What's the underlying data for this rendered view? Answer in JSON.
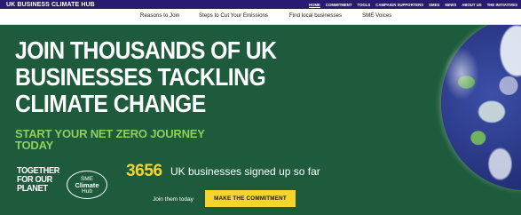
{
  "topbar": {
    "brand": "UK BUSINESS CLIMATE HUB",
    "nav": [
      "HOME",
      "COMMITMENT",
      "TOOLS",
      "CAMPAIGN SUPPORTERS",
      "SMES",
      "NEWS",
      "ABOUT US",
      "THE INITIATIVES"
    ],
    "active": "HOME",
    "background": "#2a1a73"
  },
  "subnav": {
    "items": [
      "Reasons to Join",
      "Steps to Cut Your Emissions",
      "Find local businesses",
      "SME Voices"
    ]
  },
  "hero": {
    "background": "#1d5b3c",
    "headline_lines": [
      "JOIN THOUSANDS OF UK",
      "BUSINESSES TACKLING",
      "CLIMATE CHANGE"
    ],
    "subheadline_lines": [
      "START YOUR NET ZERO JOURNEY",
      "TODAY"
    ],
    "subheadline_color": "#8dd05a",
    "logo_together_lines": [
      "TOGETHER",
      "FOR OUR",
      "PLANET"
    ],
    "logo_sme_lines": [
      "SME",
      "Climate",
      "Hub"
    ],
    "count": "3656",
    "count_color": "#f5d52c",
    "count_text": "UK businesses signed up so far",
    "join_label": "Join them today",
    "cta_label": "MAKE THE COMMITMENT",
    "cta_color": "#f5d52c",
    "globe_icon": "earth-globe-image"
  }
}
